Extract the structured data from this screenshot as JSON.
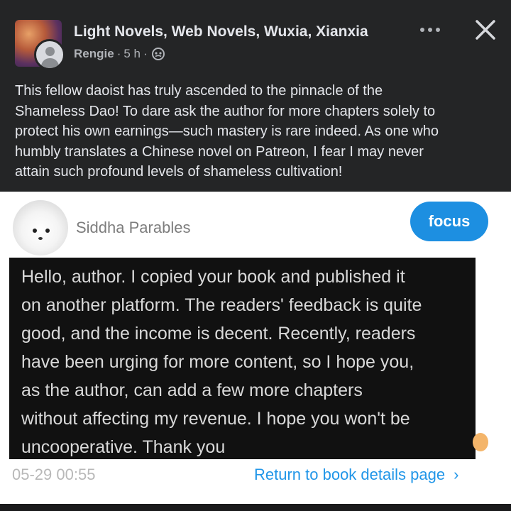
{
  "post": {
    "group_name": "Light Novels, Web Novels, Wuxia, Xianxia",
    "author": "Rengie",
    "separator": "·",
    "time": "5 h",
    "audience_icon": "group-audience-icon",
    "text_lines": [
      "This fellow daoist has truly ascended to the pinnacle of the",
      "Shameless Dao! To dare ask the author for more chapters solely to",
      "protect his own earnings—such mastery is rare indeed. As one who",
      "humbly translates a Chinese novel on Patreon, I fear I may never",
      "attain such profound levels of shameless cultivation!"
    ]
  },
  "screenshot": {
    "sender_name": "Siddha Parables",
    "focus_label": "focus",
    "message_lines": [
      "Hello, author. I copied your book and published it",
      "on another platform. The readers' feedback is quite",
      "good, and the income is decent. Recently, readers",
      "have been urging for more content, so I hope you,",
      "as the author, can add a few more chapters",
      "without affecting my revenue. I hope you won't be",
      "uncooperative. Thank you"
    ],
    "timestamp": "05-29 00:55",
    "return_link": "Return to book details page",
    "return_chevron": "›"
  },
  "colors": {
    "header_bg": "#242526",
    "link_blue": "#2196e8",
    "focus_blue": "#1d8fe1"
  }
}
